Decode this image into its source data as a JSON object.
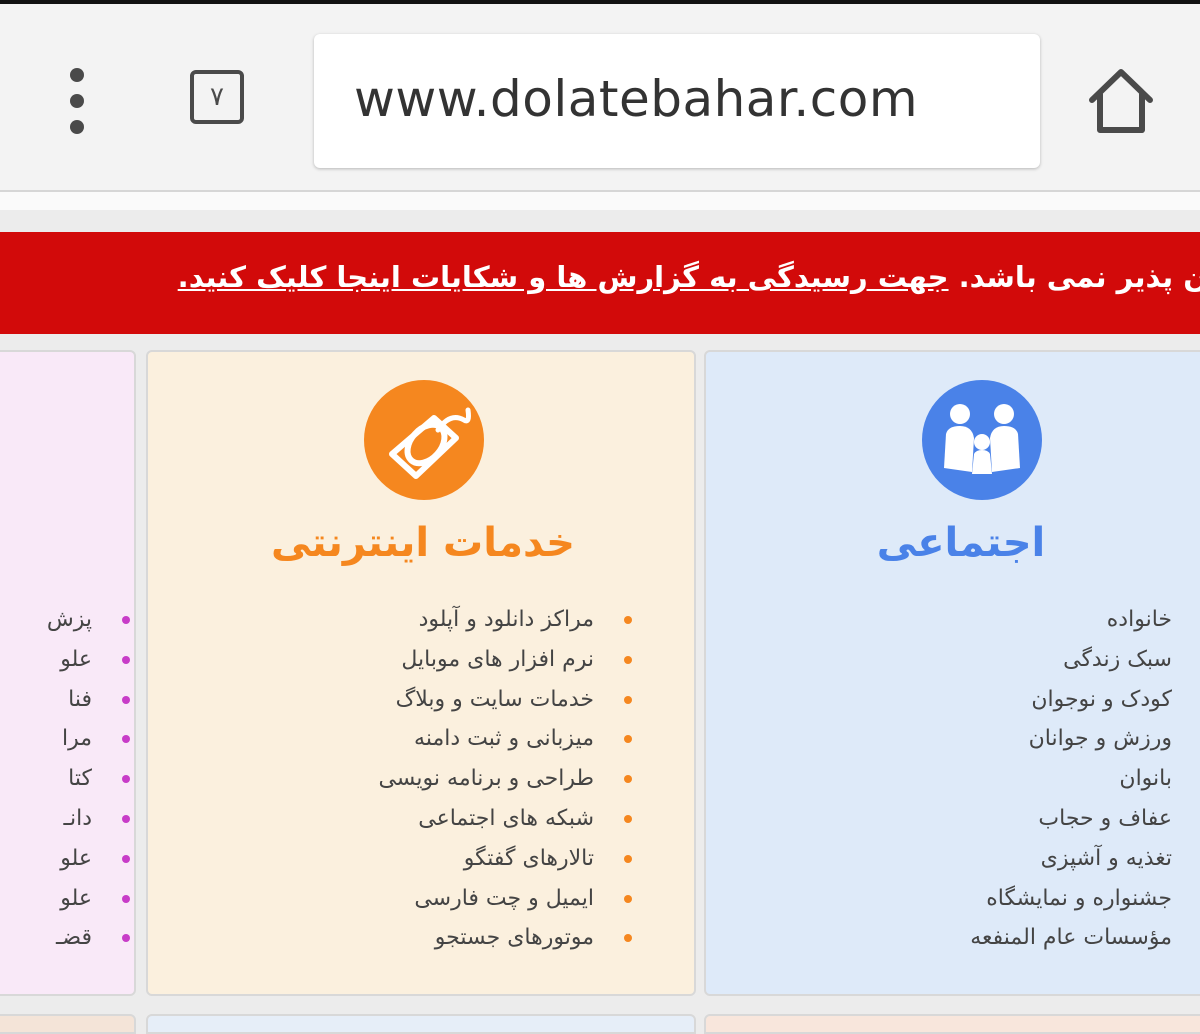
{
  "browser": {
    "url": "www.dolatebahar.com",
    "tab_count": "٧",
    "icons": {
      "menu": "kebab-menu-icon",
      "tabs": "tabs-counter-icon",
      "home": "home-icon"
    }
  },
  "banner": {
    "text_plain": "ن پذیر نمی باشد. ",
    "link_text": "جهت رسیدگی به گزارش ها و شکایات اینجا کلیک کنید.",
    "color": "#d20a0a"
  },
  "categories": {
    "left": {
      "items": [
        "پزش",
        "علو",
        "فنا",
        "مرا",
        "کتا",
        "دانـ",
        "علو",
        "علو",
        "قضـ"
      ],
      "bullet_color": "#c83cc8"
    },
    "internet": {
      "title": "خدمات اینترنتی",
      "icon": "mouse-icon",
      "color": "#f5871f",
      "items": [
        "مراکز دانلود و آپلود",
        "نرم افزار های موبایل",
        "خدمات سایت و وبلاگ",
        "میزبانی و ثبت دامنه",
        "طراحی و برنامه نویسی",
        "شبکه های اجتماعی",
        "تالارهای گفتگو",
        "ایمیل و چت فارسی",
        "موتورهای جستجو"
      ]
    },
    "social": {
      "title": "اجتماعی",
      "icon": "family-icon",
      "color": "#4a82e8",
      "items": [
        "خانواده",
        "سبک زندگی",
        "کودک و نوجوان",
        "ورزش و جوانان",
        "بانوان",
        "عفاف و حجاب",
        "تغذیه و آشپزی",
        "جشنواره و نمایشگاه",
        "مؤسسات عام المنفعه"
      ]
    }
  }
}
